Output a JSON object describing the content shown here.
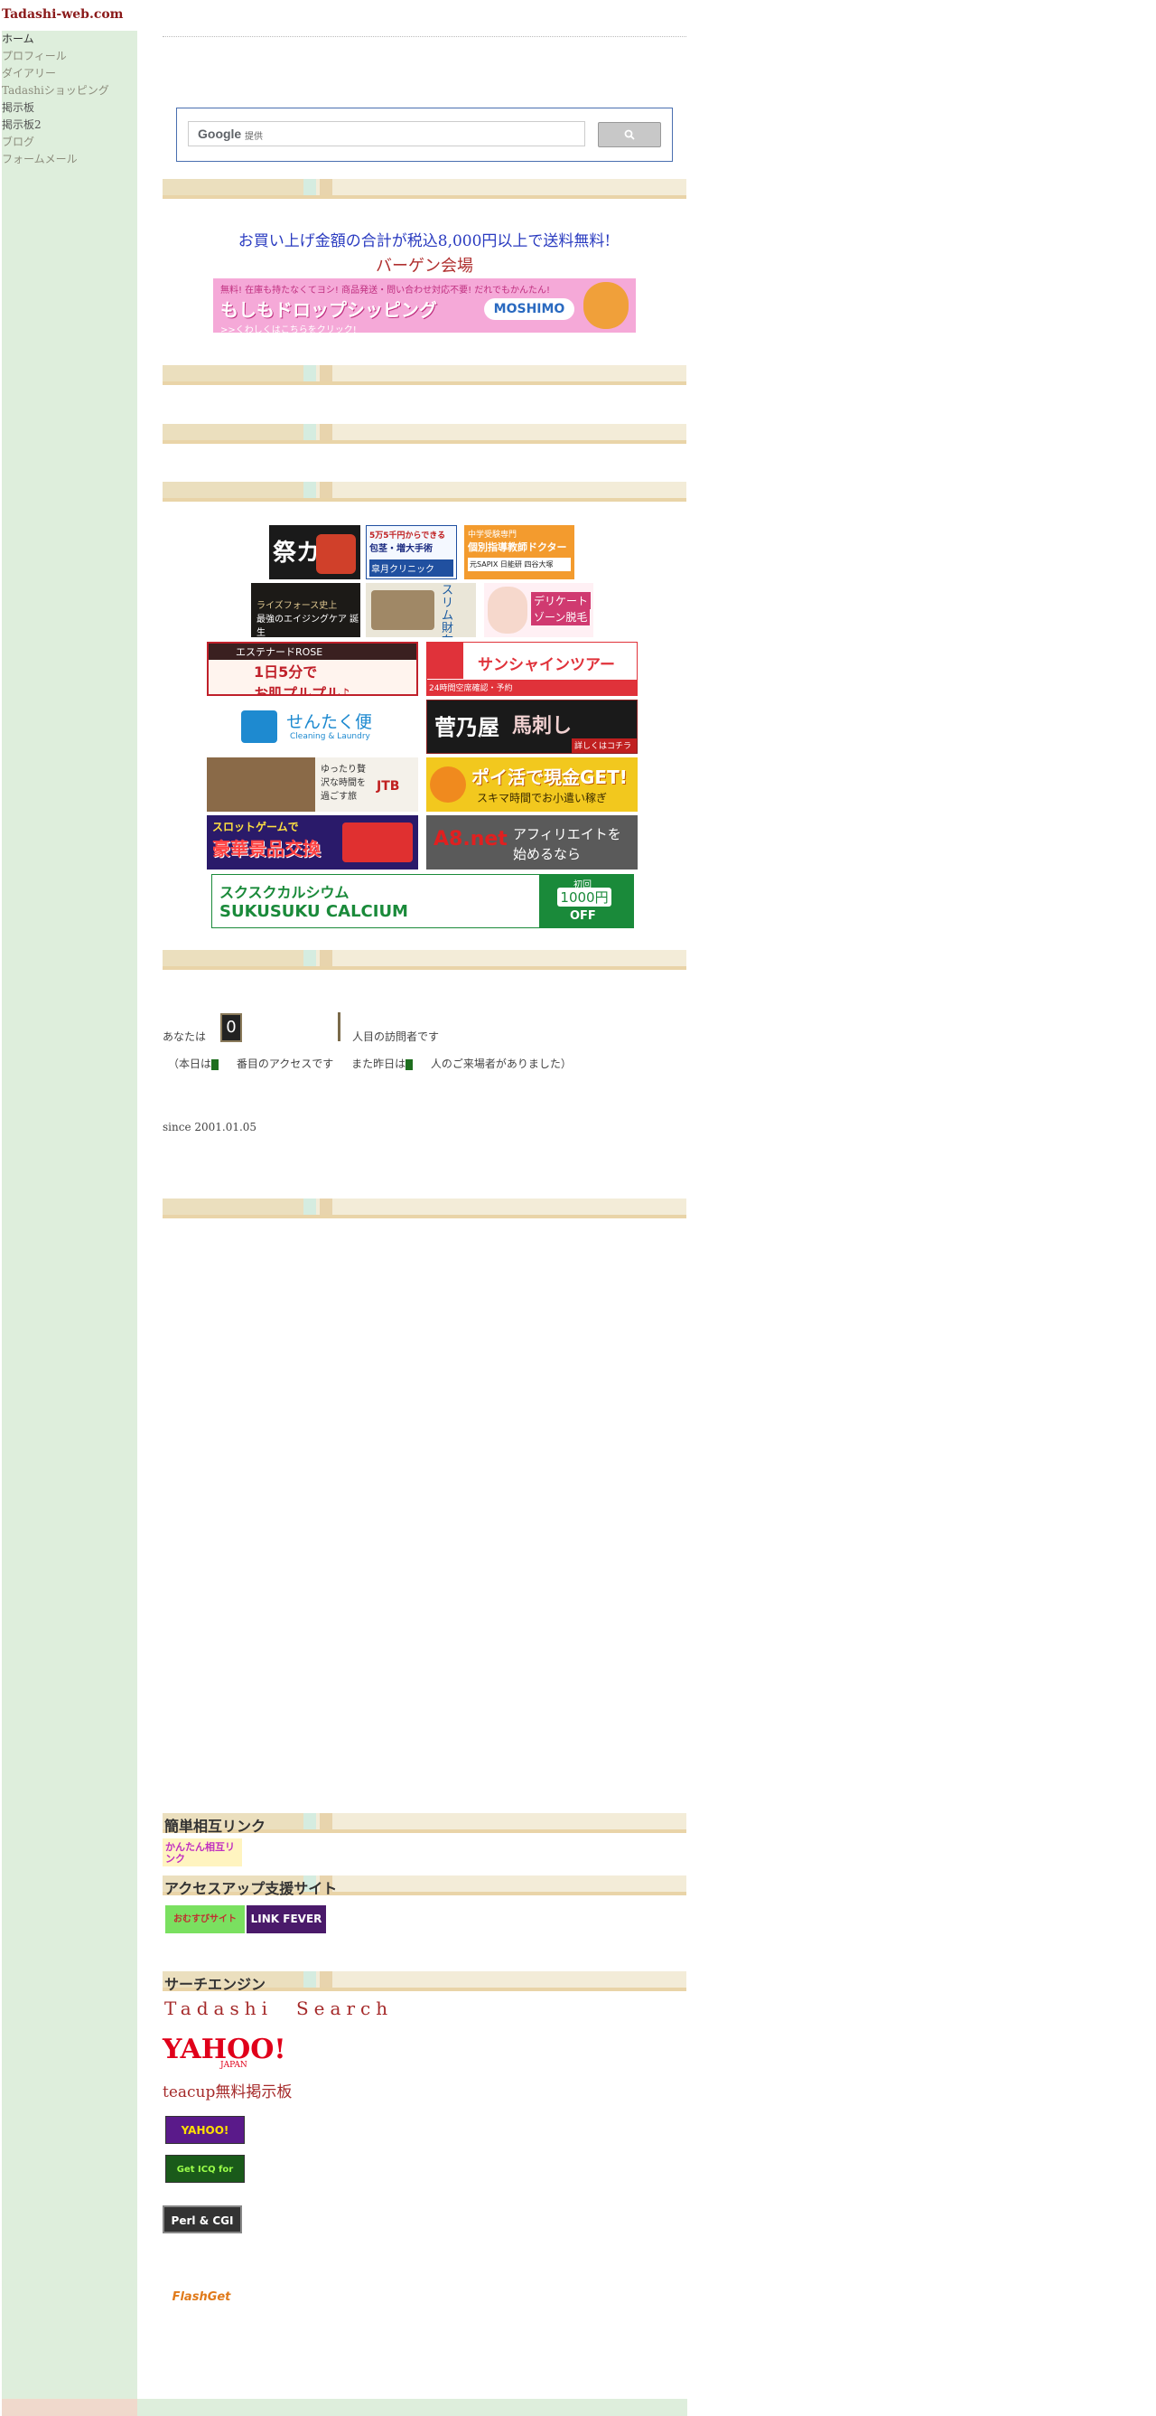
{
  "site": {
    "title": "Tadashi-web.com"
  },
  "nav": {
    "items": [
      {
        "label": "ホーム"
      },
      {
        "label": "プロフィール"
      },
      {
        "label": "ダイアリー"
      },
      {
        "label": "Tadashiショッピング"
      },
      {
        "label": "掲示板"
      },
      {
        "label": "掲示板2"
      },
      {
        "label": "ブログ"
      },
      {
        "label": "フォームメール"
      }
    ]
  },
  "search": {
    "logo": "Google",
    "sub": "提供"
  },
  "promo": {
    "shipping": "お買い上げ金額の合計が税込8,000円以上で送料無料!",
    "bargain": "バーゲン会場"
  },
  "banners": {
    "moshimo": {
      "line1": "無料! 在庫も持たなくてヨシ! 商品発送・問い合わせ対応不要! だれでもかんたん!",
      "line2": "もしもドロップシッピング",
      "line3": ">>くわしくはこちらをクリック!",
      "brand": "MOSHIMO"
    },
    "kani": "祭カニ",
    "satsuki": {
      "line1": "5万5千円からできる",
      "line2": "包茎・増大手術",
      "line3": "皐月クリニック"
    },
    "kobetsu": {
      "line1": "中学受験専門",
      "line2": "個別指導教師ドクター",
      "line3": "元SAPIX 日能研 四谷大塚"
    },
    "riseforce": {
      "line1": "ライズフォース史上",
      "line2": "最強のエイジングケア 誕生"
    },
    "slim": "スリム財布",
    "delicate": {
      "line1": "デリケート",
      "line2": "ゾーン脱毛"
    },
    "rose": {
      "line1": "エステナードROSE",
      "line2": "1日5分で",
      "line3": "お肌プルプル♪"
    },
    "sunshine": {
      "line1": "サンシャインツアー",
      "line2": "24時間空席確認・予約"
    },
    "sentaku": {
      "line1": "せんたく便",
      "line2": "Cleaning & Laundry"
    },
    "sugaya": {
      "line1": "菅乃屋",
      "line2": "馬刺し",
      "line3": "詳しくはコチラ >>"
    },
    "jtb": {
      "line1": "ゆったり贅沢な時間を過ごす旅",
      "line2": "JTB"
    },
    "poikatsu": {
      "line1": "ポイ活で現金GET!",
      "line2": "スキマ時間でお小遣い稼ぎ"
    },
    "slot": {
      "line1": "スロットゲームで",
      "line2": "豪華景品交換"
    },
    "a8": {
      "line1": "A8.net",
      "line2": "アフィリエイトを",
      "line3": "始めるなら"
    },
    "sukusuku": {
      "line1": "スクスクカルシウム",
      "line2": "SUKUSUKU CALCIUM",
      "line3": "初回",
      "line4": "1000円",
      "line5": "OFF"
    }
  },
  "counter": {
    "prefix": "あなたは",
    "digit": "0",
    "suffix": "人目の訪問者です",
    "today_prefix": "（本日は",
    "today_suffix": "番目のアクセスです",
    "yesterday_prefix": "また昨日は",
    "yesterday_suffix": "人のご来場者がありました）",
    "since": "since 2001.01.05"
  },
  "sections": {
    "mutual_links": "簡単相互リンク",
    "access_up": "アクセスアップ支援サイト",
    "search_engine": "サーチエンジン"
  },
  "links": {
    "kantan": "かんたん相互リンク",
    "search_name": "Tadashi　Search",
    "yahoo": "YAHOO!",
    "yahoo_japan": "JAPAN",
    "teacup": "teacup無料掲示板",
    "yahoo_games": "YAHOO! Games",
    "get_icq": "Get ICQ for Free",
    "perl_cgi": "Perl & CGI",
    "flashget": "FlashGet",
    "link_fever": "LINK FEVER",
    "omusubi": "おむすびサイト"
  },
  "colors": {
    "sidebar_bg": "#deeedc",
    "band_bg": "#f3ecd8",
    "title_red": "#8a1a1a",
    "promo_blue": "#2a3bc0"
  }
}
